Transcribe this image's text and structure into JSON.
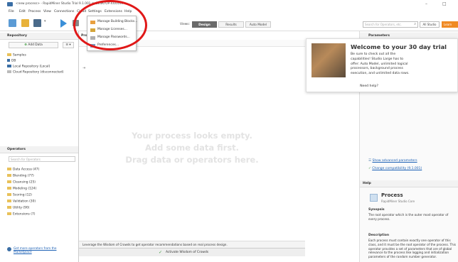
{
  "window": {
    "title": "<new process> - RapidMiner Studio Trial 9.1.001 @ DESKTOP-XXXXXX"
  },
  "menubar": [
    "File",
    "Edit",
    "Process",
    "View",
    "Connections",
    "Cloud",
    "Settings",
    "Extensions",
    "Help"
  ],
  "settings_menu": {
    "items": [
      "Manage Building Blocks...",
      "Manage Licenses...",
      "Manage Passwords...",
      "Preferences..."
    ]
  },
  "views": {
    "items": [
      "Views:",
      "Design",
      "Results",
      "Auto Model"
    ],
    "active": "Design"
  },
  "search": {
    "placeholder": "Search for Operators, etc.",
    "scope": "All Studio",
    "learn": "Learn"
  },
  "repository": {
    "title": "Repository",
    "add_data": "Add Data",
    "items": [
      "Samples",
      "DB",
      "Local Repository (Local)",
      "Cloud Repository (disconnected)"
    ]
  },
  "operators": {
    "title": "Operators",
    "search_placeholder": "Search for Operators",
    "items": [
      "Data Access (47)",
      "Blending (77)",
      "Cleansing (25)",
      "Modeling (124)",
      "Scoring (12)",
      "Validation (30)",
      "Utility (90)",
      "Extensions (7)"
    ],
    "marketplace_link": "Get more operators from the Marketplace"
  },
  "process": {
    "tab_label": "Pro",
    "empty_line1": "Your process looks empty.",
    "empty_line2": "Add some data first.",
    "empty_line3": "Drag data or operators here.",
    "wisdom_text": "Leverage the Wisdom of Crowds to get operator recommendations based on real process design.",
    "wisdom_button": "Activate Wisdom of Crowds"
  },
  "parameters": {
    "title": "Parameters",
    "show_advanced": "Show advanced parameters",
    "change_compat": "Change compatibility (9.1.001)"
  },
  "help": {
    "title": "Help",
    "op_name": "Process",
    "op_sub": "RapidMiner Studio Core",
    "synopsis_h": "Synopsis",
    "synopsis": "The root operator which is the outer most operator of every process.",
    "description_h": "Description",
    "description": "Each process must contain exactly one operator of this class, and it must be the root operator of the process. This operator provides a set of parameters that are of global relevance to the process like logging and initialization parameters of the random number generator."
  },
  "trial_popup": {
    "title": "Welcome to your 30 day trial",
    "body": "Be sure to check out all the capabilities! Studio Large has to offer: Auto Model, unlimited logical processors, background process execution, and unlimited data rows.",
    "help": "Need help?"
  },
  "colors": {
    "accent": "#f08a24",
    "highlight_circle": "#e01818",
    "active_view": "#6a6a6a"
  }
}
